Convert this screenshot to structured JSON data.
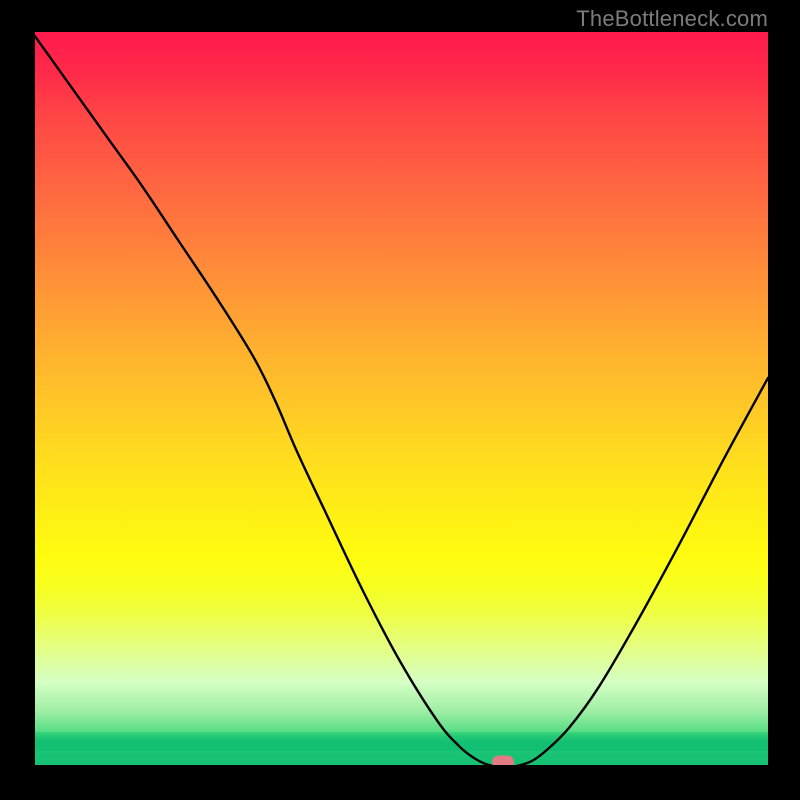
{
  "watermark": "TheBottleneck.com",
  "chart_data": {
    "type": "line",
    "title": "",
    "xlabel": "",
    "ylabel": "",
    "xlim": [
      0,
      100
    ],
    "ylim": [
      0,
      100
    ],
    "grid": false,
    "legend": false,
    "bg_gradient": {
      "top": "#ff1a4d",
      "mid": "#ffdc1e",
      "low": "#f0ff40",
      "bottom": "#17c274"
    },
    "series": [
      {
        "name": "curve",
        "stroke": "#000000",
        "x": [
          0,
          5,
          10,
          15,
          20,
          25,
          30,
          33,
          36,
          40,
          45,
          50,
          55,
          58,
          60,
          61.5,
          63,
          64.5,
          66,
          68,
          70,
          73,
          77,
          82,
          88,
          94,
          100
        ],
        "values": [
          100,
          93,
          86,
          79,
          71.5,
          64,
          56,
          50,
          43,
          34.5,
          24,
          14.5,
          6.5,
          3,
          1.4,
          0.6,
          0.2,
          0.15,
          0.3,
          1.0,
          2.5,
          5.5,
          11,
          19.5,
          30.5,
          42,
          53
        ]
      }
    ],
    "marker": {
      "name": "optimal-point",
      "x": 64,
      "y": 0.8,
      "color": "#e37b84"
    }
  }
}
